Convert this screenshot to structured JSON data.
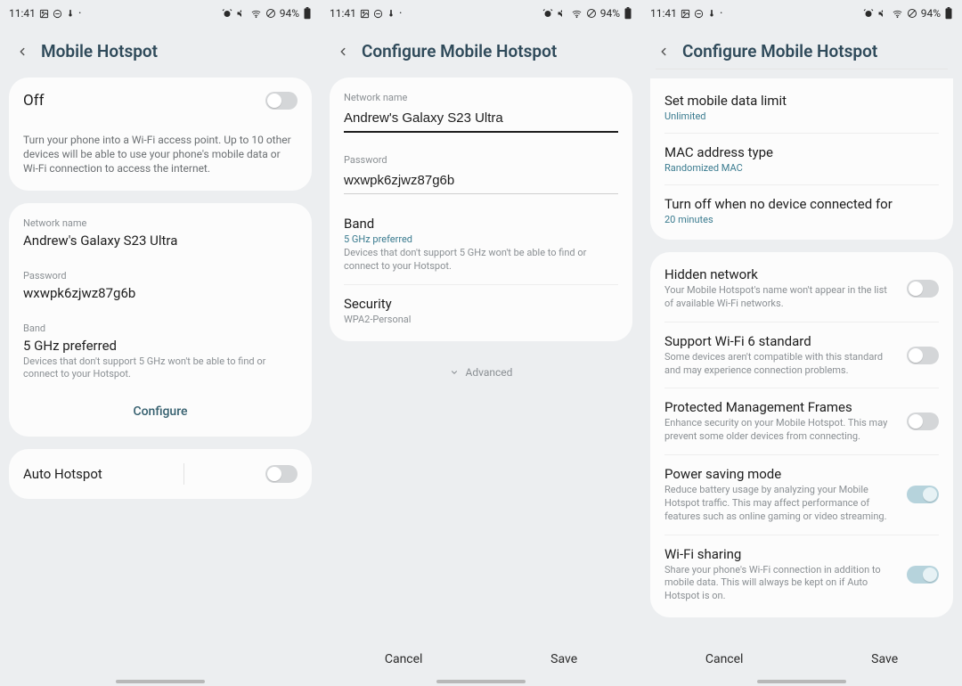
{
  "status": {
    "time": "11:41",
    "battery": "94%"
  },
  "screen1": {
    "title": "Mobile Hotspot",
    "state": "Off",
    "desc": "Turn your phone into a Wi-Fi access point. Up to 10 other devices will be able to use your phone's mobile data or Wi-Fi connection to access the internet.",
    "network_name_label": "Network name",
    "network_name": "Andrew's Galaxy S23 Ultra",
    "password_label": "Password",
    "password": "wxwpk6zjwz87g6b",
    "band_label": "Band",
    "band": "5 GHz preferred",
    "band_helper": "Devices that don't support 5 GHz won't be able to find or connect to your Hotspot.",
    "configure": "Configure",
    "auto_hotspot": "Auto Hotspot"
  },
  "screen2": {
    "title": "Configure Mobile Hotspot",
    "network_name_label": "Network name",
    "network_name": "Andrew's Galaxy S23 Ultra",
    "password_label": "Password",
    "password": "wxwpk6zjwz87g6b",
    "band_label": "Band",
    "band_value": "5 GHz preferred",
    "band_helper": "Devices that don't support 5 GHz won't be able to find or connect to your Hotspot.",
    "security_label": "Security",
    "security_value": "WPA2-Personal",
    "advanced": "Advanced",
    "cancel": "Cancel",
    "save": "Save"
  },
  "screen3": {
    "title": "Configure Mobile Hotspot",
    "items_a": [
      {
        "title": "Set mobile data limit",
        "sub": "Unlimited"
      },
      {
        "title": "MAC address type",
        "sub": "Randomized MAC"
      },
      {
        "title": "Turn off when no device connected for",
        "sub": "20 minutes"
      }
    ],
    "items_b": [
      {
        "title": "Hidden network",
        "sub": "Your Mobile Hotspot's name won't appear in the list of available Wi-Fi networks.",
        "on": false
      },
      {
        "title": "Support Wi-Fi 6 standard",
        "sub": "Some devices aren't compatible with this standard and may experience connection problems.",
        "on": false
      },
      {
        "title": "Protected Management Frames",
        "sub": "Enhance security on your Mobile Hotspot. This may prevent some older devices from connecting.",
        "on": false
      },
      {
        "title": "Power saving mode",
        "sub": "Reduce battery usage by analyzing your Mobile Hotspot traffic. This may affect performance of features such as online gaming or video streaming.",
        "on": true
      },
      {
        "title": "Wi-Fi sharing",
        "sub": "Share your phone's Wi-Fi connection in addition to mobile data. This will always be kept on if Auto Hotspot is on.",
        "on": true
      }
    ],
    "cancel": "Cancel",
    "save": "Save"
  }
}
